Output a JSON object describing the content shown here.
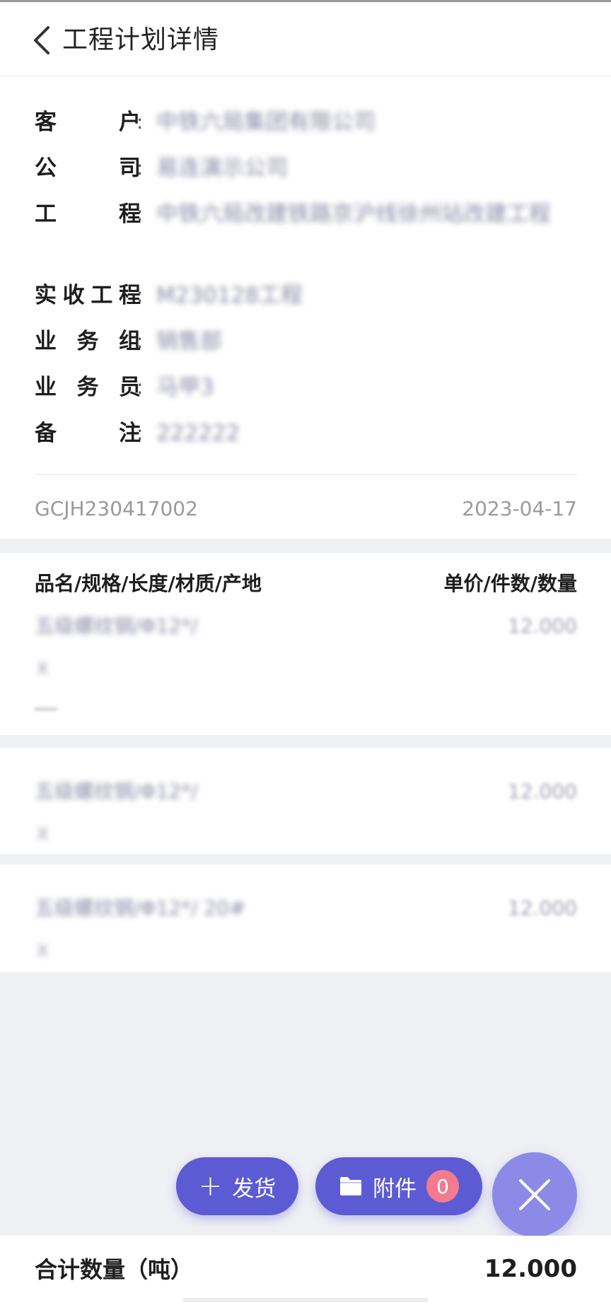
{
  "header": {
    "title": "工程计划详情"
  },
  "info": {
    "customer": {
      "label_chars": [
        "客",
        "户"
      ],
      "colon": ":",
      "value": "中铁六局集团有限公司"
    },
    "company": {
      "label_chars": [
        "公",
        "司"
      ],
      "colon": ":",
      "value": "易连演示公司"
    },
    "project": {
      "label_chars": [
        "工",
        "程"
      ],
      "colon": ":",
      "value": "中铁六局改建铁路京沪线徐州站改建工程"
    },
    "actual_project": {
      "label_chars": [
        "实",
        "收",
        "工",
        "程"
      ],
      "colon": ":",
      "value": "M230128工程"
    },
    "business_group": {
      "label_chars": [
        "业",
        "务",
        "组"
      ],
      "colon": ":",
      "value": "销售部"
    },
    "salesman": {
      "label_chars": [
        "业",
        "务",
        "员"
      ],
      "colon": ":",
      "value": "马甲3"
    },
    "remark": {
      "label_chars": [
        "备",
        "注"
      ],
      "colon": ":",
      "value": "222222"
    },
    "code": "GCJH230417002",
    "date": "2023-04-17"
  },
  "items": {
    "header_left": "品名/规格/长度/材质/产地",
    "header_right": "单价/件数/数量",
    "rows": [
      {
        "name": "五级螺纹钢/Φ12*/",
        "qty": "12.000",
        "sub": "X"
      },
      {
        "name": "五级螺纹钢/Φ12*/",
        "qty": "12.000",
        "sub": "X"
      },
      {
        "name": "五级螺纹钢/Φ12*/ 20#",
        "qty": "12.000",
        "sub": "X"
      }
    ]
  },
  "actions": {
    "ship_label": "发货",
    "attach_label": "附件",
    "attach_count": "0"
  },
  "footer": {
    "total_label": "合计数量（吨）",
    "total_value": "12.000"
  },
  "colors": {
    "accent": "#5c5bd4",
    "close_button": "#8c8ae6",
    "badge": "#f37a8f"
  }
}
